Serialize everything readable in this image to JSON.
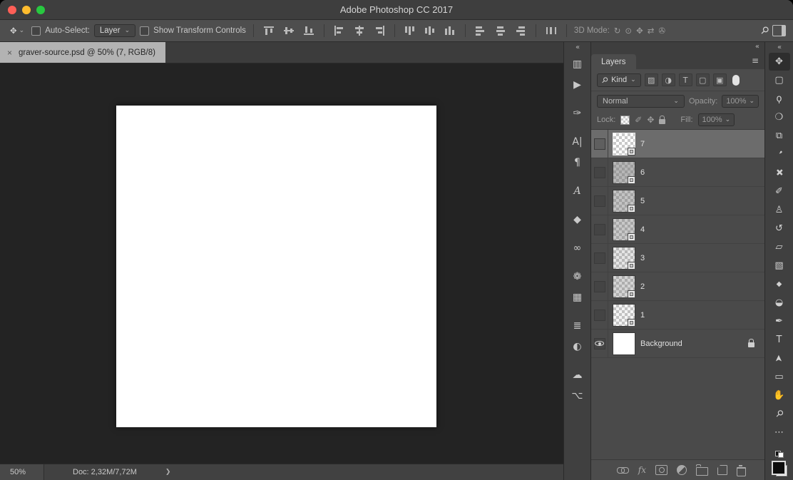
{
  "window": {
    "title": "Adobe Photoshop CC 2017"
  },
  "icons": {
    "collapse": "«",
    "menu": "≡",
    "chevron_down": "⌄",
    "search": "⚲",
    "brush": "✐",
    "move": "✥",
    "tab_close": "×",
    "status_chevron": "❯"
  },
  "options_bar": {
    "tool_icon": "✥",
    "auto_select_label": "Auto-Select:",
    "auto_select_value": "Layer",
    "show_transform_label": "Show Transform Controls",
    "mode_3d_label": "3D Mode:",
    "mode_3d_icons": [
      "↻",
      "⊙",
      "✥",
      "⇄",
      "✇"
    ]
  },
  "tab": {
    "title": "graver-source.psd @ 50% (7, RGB/8)"
  },
  "status_bar": {
    "zoom": "50%",
    "doc": "Doc: 2,32M/7,72M"
  },
  "dock_panels": [
    {
      "name": "histogram",
      "glyph": "▥"
    },
    {
      "name": "actions",
      "glyph": "▶"
    },
    {
      "name": "tool-presets",
      "glyph": "✑"
    },
    {
      "name": "character",
      "glyph": "A|"
    },
    {
      "name": "paragraph",
      "glyph": "¶"
    },
    {
      "name": "glyphs",
      "glyph": "A"
    },
    {
      "name": "styles",
      "glyph": "◆"
    },
    {
      "name": "clone-source",
      "glyph": "∞"
    },
    {
      "name": "brush-settings",
      "glyph": "❁"
    },
    {
      "name": "swatches",
      "glyph": "▦"
    },
    {
      "name": "paragraph-styles",
      "glyph": "≣"
    },
    {
      "name": "adjustments",
      "glyph": "◐"
    },
    {
      "name": "libraries",
      "glyph": "☁"
    },
    {
      "name": "timeline",
      "glyph": "⌥"
    }
  ],
  "tools": [
    {
      "name": "move",
      "glyph": "✥",
      "selected": true
    },
    {
      "name": "rectangular-marquee",
      "glyph": "▢"
    },
    {
      "name": "lasso",
      "glyph": "ϙ"
    },
    {
      "name": "quick-selection",
      "glyph": "❍"
    },
    {
      "name": "crop",
      "glyph": "⧉"
    },
    {
      "name": "eyedropper",
      "glyph": "❜"
    },
    {
      "name": "spot-healing-brush",
      "glyph": "✚"
    },
    {
      "name": "brush",
      "glyph": "✐"
    },
    {
      "name": "clone-stamp",
      "glyph": "♙"
    },
    {
      "name": "history-brush",
      "glyph": "↺"
    },
    {
      "name": "eraser",
      "glyph": "▱"
    },
    {
      "name": "gradient",
      "glyph": "▧"
    },
    {
      "name": "blur",
      "glyph": "◆"
    },
    {
      "name": "dodge",
      "glyph": "◒"
    },
    {
      "name": "pen",
      "glyph": "✒"
    },
    {
      "name": "type",
      "glyph": "T"
    },
    {
      "name": "path-selection",
      "glyph": "➤"
    },
    {
      "name": "rectangle",
      "glyph": "▭"
    },
    {
      "name": "hand",
      "glyph": "✋"
    },
    {
      "name": "zoom",
      "glyph": "⚲"
    },
    {
      "name": "edit-toolbar",
      "glyph": "⋯"
    }
  ],
  "layers_panel": {
    "title": "Layers",
    "kind_label": "Kind",
    "filter_icons": [
      {
        "name": "pixel-filter",
        "glyph": "▨"
      },
      {
        "name": "adjustment-filter",
        "glyph": "◑"
      },
      {
        "name": "type-filter",
        "glyph": "T"
      },
      {
        "name": "shape-filter",
        "glyph": "▢"
      },
      {
        "name": "smart-object-filter",
        "glyph": "▣"
      }
    ],
    "blend_mode": "Normal",
    "opacity_label": "Opacity:",
    "opacity_value": "100%",
    "lock_label": "Lock:",
    "fill_label": "Fill:",
    "fill_value": "100%",
    "footer_fx": "fx",
    "rows": [
      {
        "name": "7",
        "selected": true,
        "visible": false,
        "smart_object": true,
        "shade": 0
      },
      {
        "name": "6",
        "selected": false,
        "visible": false,
        "smart_object": true,
        "shade": 0.5
      },
      {
        "name": "5",
        "selected": false,
        "visible": false,
        "smart_object": true,
        "shade": 0.42
      },
      {
        "name": "4",
        "selected": false,
        "visible": false,
        "smart_object": true,
        "shade": 0.38
      },
      {
        "name": "3",
        "selected": false,
        "visible": false,
        "smart_object": true,
        "shade": 0.18
      },
      {
        "name": "2",
        "selected": false,
        "visible": false,
        "smart_object": true,
        "shade": 0.3
      },
      {
        "name": "1",
        "selected": false,
        "visible": false,
        "smart_object": true,
        "shade": 0.08
      },
      {
        "name": "Background",
        "selected": false,
        "visible": true,
        "locked": true,
        "shade": 0
      }
    ]
  }
}
